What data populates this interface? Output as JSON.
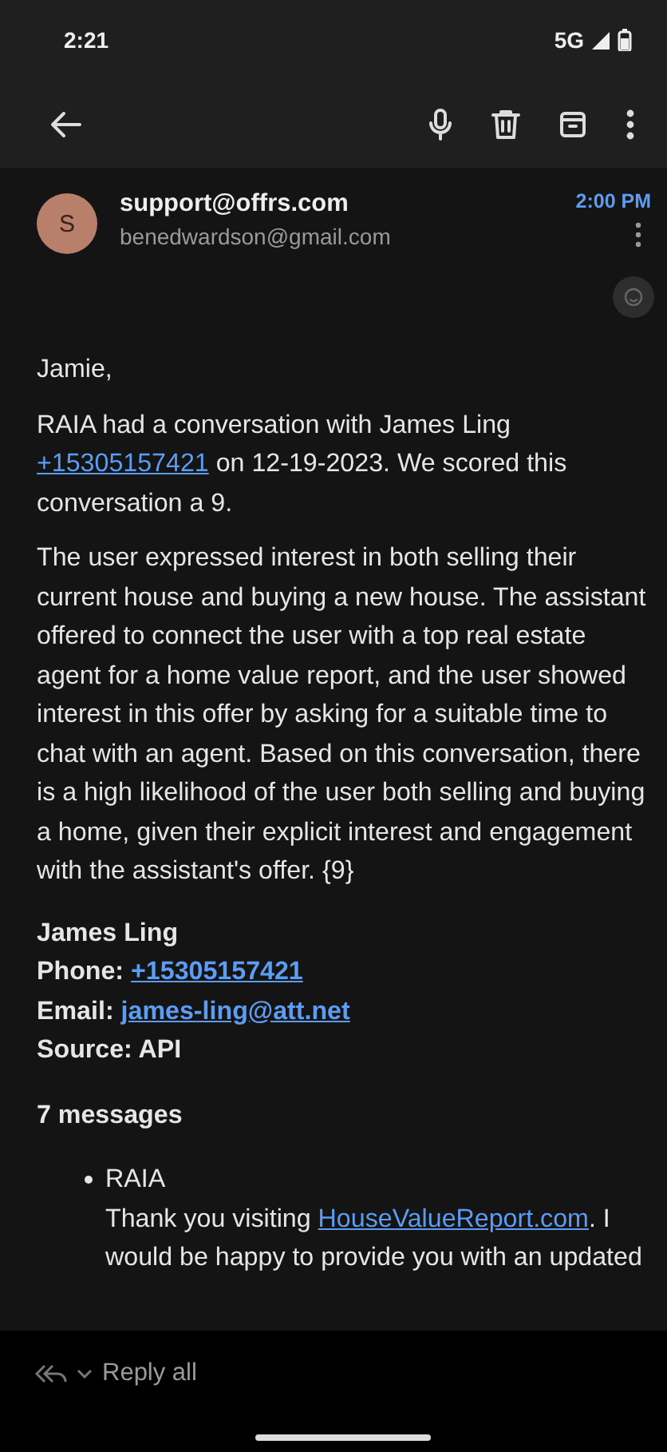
{
  "status_bar": {
    "time": "2:21",
    "network": "5G"
  },
  "header": {
    "avatar_letter": "S",
    "sender": "support@offrs.com",
    "recipient": "benedwardson@gmail.com",
    "time": "2:00 PM"
  },
  "body": {
    "greeting": "Jamie,",
    "paragraphs": [
      [
        {
          "kind": "text",
          "text": "RAIA had a conversation with James Ling "
        },
        {
          "kind": "link",
          "text": "+15305157421"
        },
        {
          "kind": "text",
          "text": " on 12-19-2023. We scored this conversation a 9."
        }
      ],
      [
        {
          "kind": "text",
          "text": "The user expressed interest in both selling their current house and buying a new house. The assistant offered to connect the user with a top real estate agent for a home value report, and the user showed interest in this offer by asking for a suitable time to chat with an agent. Based on this conversation, there is a high likelihood of the user both selling and buying a home, given their explicit interest and engagement with the assistant's offer. {9}"
        }
      ]
    ],
    "contact": [
      {
        "kind": "plain",
        "label": "James Ling"
      },
      {
        "kind": "link",
        "label": "Phone:",
        "value": "+15305157421"
      },
      {
        "kind": "link",
        "label": "Email:",
        "value": "james-ling@att.net"
      },
      {
        "kind": "plain",
        "label": "Source: API"
      }
    ],
    "messages_heading": "7 messages",
    "messages": [
      {
        "author": "RAIA",
        "parts": [
          {
            "kind": "text",
            "text": "Thank you visiting "
          },
          {
            "kind": "link",
            "text": "HouseValueReport.com"
          },
          {
            "kind": "text",
            "text": ". I would be happy to provide you with an updated"
          }
        ]
      }
    ]
  },
  "bottom_bar": {
    "reply_label": "Reply all"
  }
}
